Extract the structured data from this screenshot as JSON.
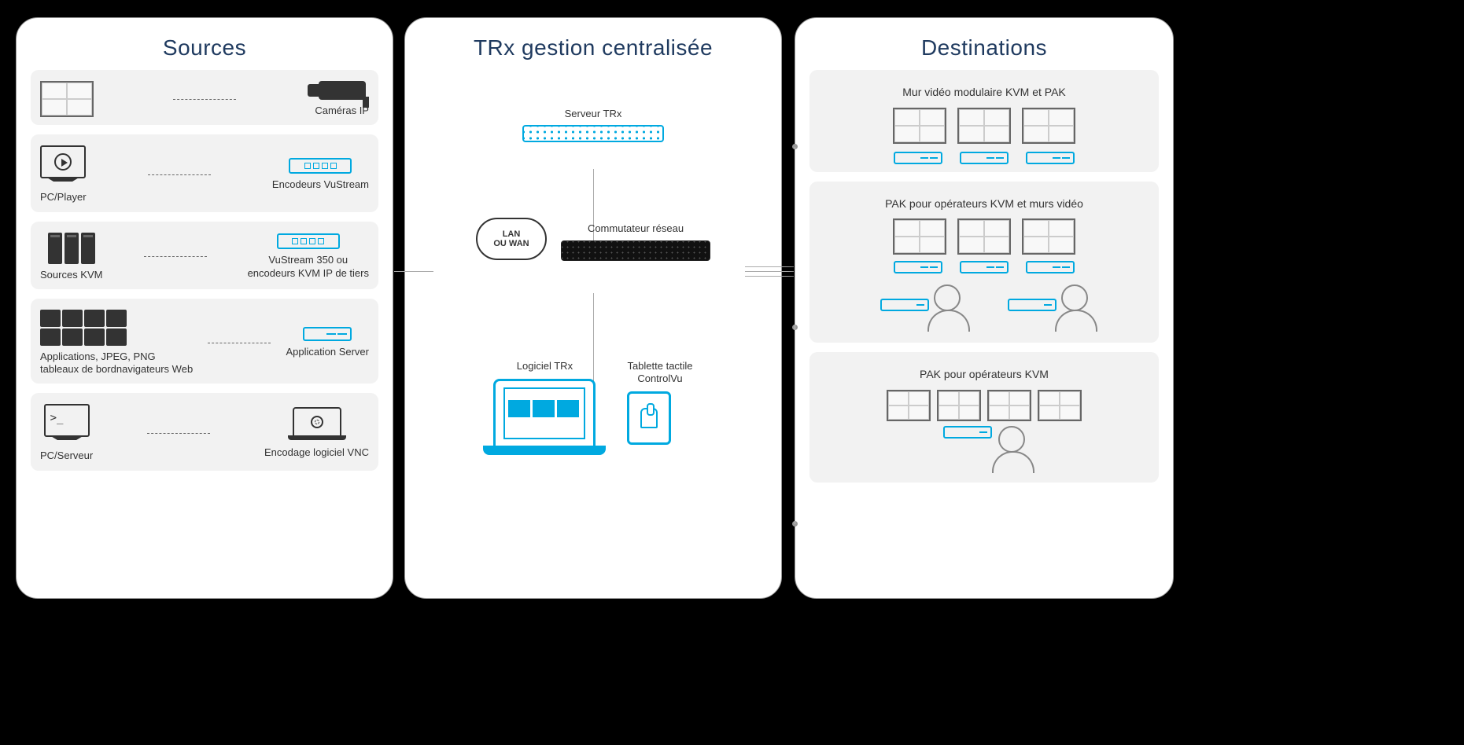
{
  "cols": {
    "sources": {
      "title": "Sources",
      "items": [
        {
          "right": "Caméras IP"
        },
        {
          "left": "PC/Player",
          "right": "Encodeurs VuStream"
        },
        {
          "left": "Sources KVM",
          "right": "VuStream 350 ou\nencodeurs KVM IP de tiers"
        },
        {
          "left": "Applications, JPEG, PNG\ntableaux de bordnavigateurs Web",
          "right": "Application Server"
        },
        {
          "left": "PC/Serveur",
          "right": "Encodage logiciel VNC"
        }
      ]
    },
    "center": {
      "title": "TRx gestion centralisée",
      "server": "Serveur TRx",
      "switch": "Commutateur réseau",
      "cloud": "LAN\nOU WAN",
      "software": "Logiciel TRx",
      "tablet": "Tablette tactile\nControlVu"
    },
    "dest": {
      "title": "Destinations",
      "items": [
        {
          "t": "Mur vidéo modulaire KVM et PAK"
        },
        {
          "t": "PAK pour opérateurs KVM et murs vidéo"
        },
        {
          "t": "PAK pour opérateurs KVM"
        }
      ]
    }
  }
}
